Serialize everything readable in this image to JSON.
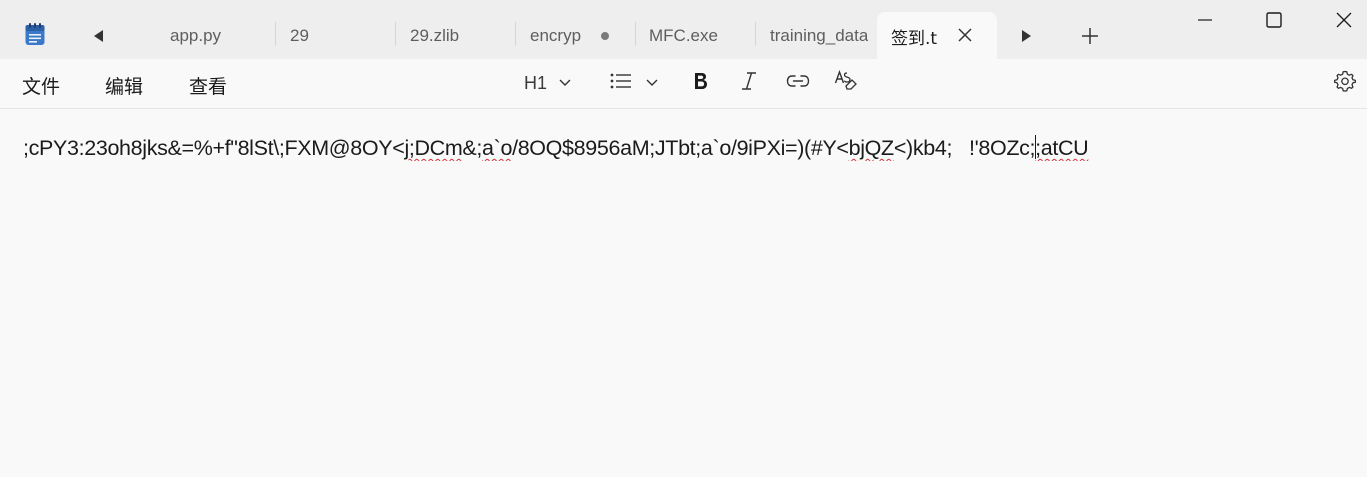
{
  "tabs": [
    {
      "label": "app.py",
      "active": false
    },
    {
      "label": "29",
      "active": false
    },
    {
      "label": "29.zlib",
      "active": false
    },
    {
      "label": "encryp",
      "active": false,
      "unsaved": true
    },
    {
      "label": "MFC.exe",
      "active": false
    },
    {
      "label": "training_data",
      "active": false
    },
    {
      "label": "签到.t",
      "active": true
    }
  ],
  "menu": {
    "file": "文件",
    "edit": "编辑",
    "view": "查看"
  },
  "format": {
    "heading_label": "H1"
  },
  "editor": {
    "seg1": ";cPY3:23oh8jks&=%+f\"8lSt\\;FXM@8OY<",
    "seg2": "j;DCm",
    "seg3": "&;",
    "seg4": "a`o",
    "seg5": "/8OQ$8956aM;JTbt;a`o/9iPXi=)(#Y<",
    "seg6": "bjQZ",
    "seg7": "<)kb4;   !'8OZc;",
    "seg8": ";atCU"
  },
  "icons": {
    "app": "notepad-icon",
    "tab_prev": "triangle-left-icon",
    "tab_next": "triangle-right-icon",
    "new_tab": "plus-icon",
    "minimize": "minimize-icon",
    "maximize": "maximize-icon",
    "close": "close-icon",
    "list": "bulleted-list-icon",
    "bold": "bold-icon",
    "italic": "italic-icon",
    "link": "link-icon",
    "clear_format": "clear-formatting-icon",
    "settings": "gear-icon"
  },
  "colors": {
    "tab_bar": "#eeeeee",
    "editor_bg": "#f9f9f9",
    "spell_error": "#d13438"
  }
}
